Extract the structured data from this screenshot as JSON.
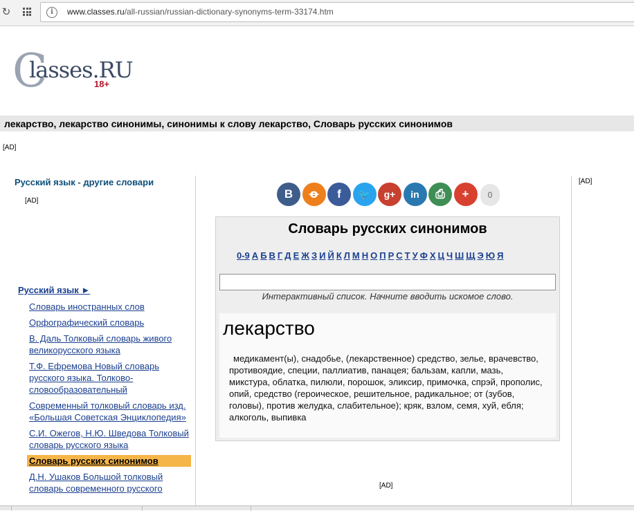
{
  "browser": {
    "url_host": "www.classes.ru",
    "url_path": "/all-russian/russian-dictionary-synonyms-term-33174.htm"
  },
  "logo": {
    "brand_initial": "C",
    "brand_rest": "lasses.RU",
    "age_badge": "18+"
  },
  "page_title": "лекарство, лекарство синонимы, синонимы к слову лекарство, Словарь русских синонимов",
  "ads": {
    "top": "[AD]",
    "left": "[AD]",
    "right": "[AD]",
    "bottom": "[AD]"
  },
  "left_column": {
    "heading": "Русский язык - другие словари",
    "section_link": "Русский язык ►",
    "links": [
      "Словарь иностранных слов",
      "Орфографический словарь",
      "В. Даль Толковый словарь живого великорусского языка",
      "Т.Ф. Ефремова Новый словарь русского языка. Толково-словообразовательный",
      "Современный толковый словарь изд. «Большая Советская Энциклопедия»",
      "С.И. Ожегов, Н.Ю. Шведова Толковый словарь русского языка",
      "Словарь русских синонимов",
      "Д.Н. Ушаков Большой толковый словарь современного русского"
    ],
    "active_index": 6
  },
  "social": {
    "buttons": [
      {
        "name": "vk-icon",
        "glyph": "B",
        "color": "#3f5d8a"
      },
      {
        "name": "odnoklassniki-icon",
        "glyph": "ꝋ",
        "color": "#ed7f1c"
      },
      {
        "name": "facebook-icon",
        "glyph": "f",
        "color": "#3b5b99"
      },
      {
        "name": "twitter-icon",
        "glyph": "🐦",
        "color": "#2aa3ef"
      },
      {
        "name": "google-plus-icon",
        "glyph": "g+",
        "color": "#c8402f"
      },
      {
        "name": "linkedin-icon",
        "glyph": "in",
        "color": "#2a78b0"
      },
      {
        "name": "print-icon",
        "glyph": "⎙",
        "color": "#3f8e55"
      },
      {
        "name": "share-more-icon",
        "glyph": "+",
        "color": "#d8412f"
      }
    ],
    "count": "0"
  },
  "dictionary": {
    "title": "Словарь русских синонимов",
    "alphabet": [
      "0-9",
      "А",
      "Б",
      "В",
      "Г",
      "Д",
      "Е",
      "Ж",
      "З",
      "И",
      "Й",
      "К",
      "Л",
      "М",
      "Н",
      "О",
      "П",
      "Р",
      "С",
      "Т",
      "У",
      "Ф",
      "Х",
      "Ц",
      "Ч",
      "Ш",
      "Щ",
      "Э",
      "Ю",
      "Я"
    ],
    "search_value": "",
    "hint": "Интерактивный список. Начните вводить искомое слово.",
    "entry_word": "лекарство",
    "entry_synonyms": "медикамент(ы), снадобье, (лекарственное) средство, зелье, врачевство, противоядие, специи, паллиатив, панацея; бальзам, капли, мазь, микстура, облатка, пилюли, порошок, эликсир, примочка, спрэй, прополис, опий, средство (героическое, решительное, радикальное; от (зубов, головы), против желудка, слабительное); кряк, взлом, семя, хуй, ебля; алкоголь, выпивка"
  }
}
